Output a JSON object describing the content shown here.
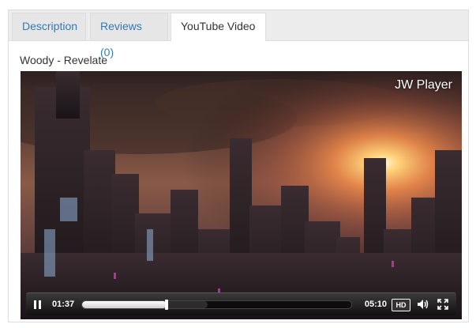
{
  "tabs": [
    {
      "label": "Description"
    },
    {
      "label": "Reviews (0)"
    },
    {
      "label": "YouTube Video"
    }
  ],
  "active_tab": "YouTube Video",
  "video": {
    "title": "Woody - Revelate"
  },
  "player": {
    "brand": "JW Player",
    "current_time": "01:37",
    "duration": "05:10",
    "hd_label": "HD",
    "progress_fraction": 0.313,
    "buffered_fraction": 0.465
  },
  "colors": {
    "link": "#337ab7",
    "tab_bg": "#e6e6e6",
    "active_tab_bg": "#ffffff",
    "control_bar": "#1a1a1a"
  },
  "icons": {
    "play_pause": "pause-icon",
    "hd": "hd-icon",
    "volume": "volume-icon",
    "fullscreen": "fullscreen-icon"
  }
}
